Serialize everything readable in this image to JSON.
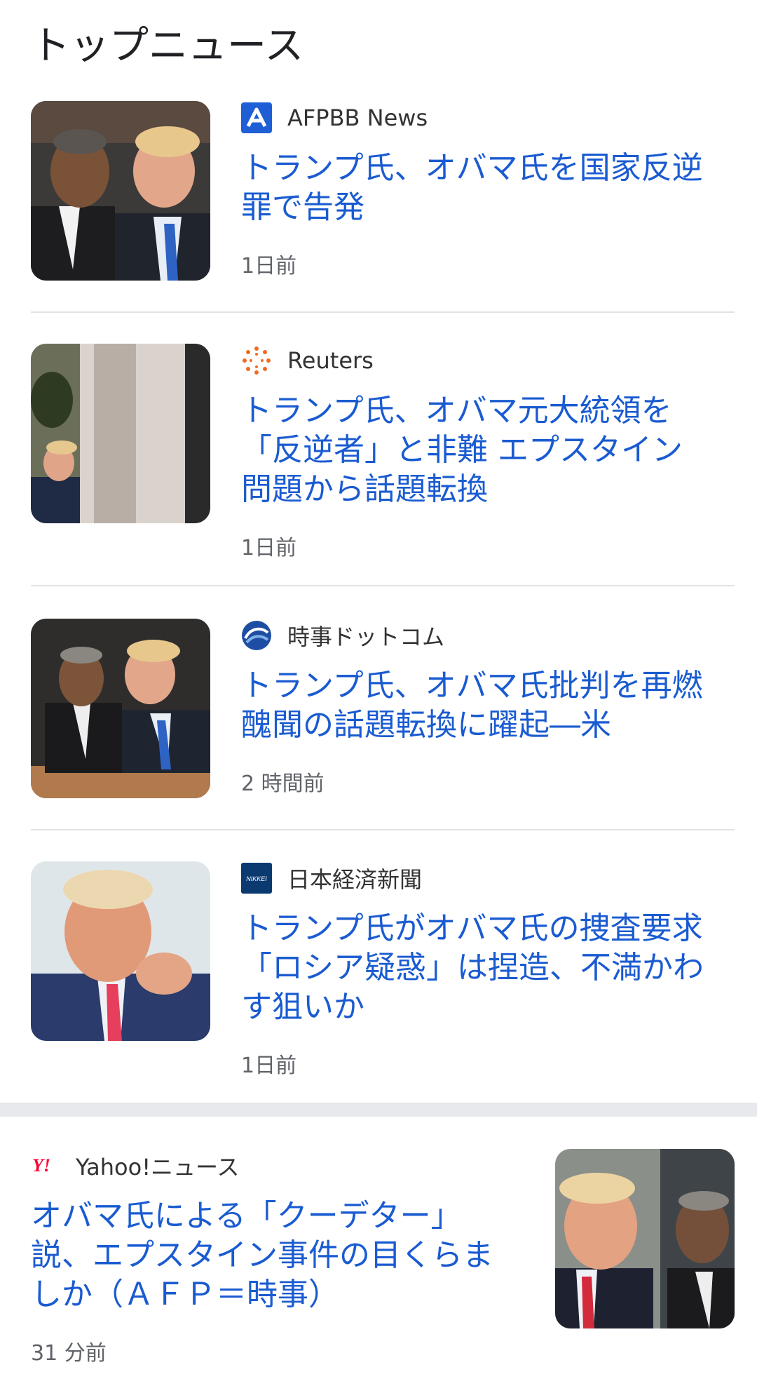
{
  "section": {
    "title": "トップニュース"
  },
  "articles": [
    {
      "source": "AFPBB News",
      "source_icon": "afpbb-logo-icon",
      "headline": "トランプ氏、オバマ氏を国家反逆罪で告発",
      "time": "1日前",
      "image": "obama-trump-conversation-photo"
    },
    {
      "source": "Reuters",
      "source_icon": "reuters-logo-icon",
      "headline": "トランプ氏、オバマ元大統領を「反逆者」と非難 エプスタイン問題から話題転換",
      "time": "1日前",
      "image": "trump-behind-pillar-photo"
    },
    {
      "source": "時事ドットコム",
      "source_icon": "jiji-logo-icon",
      "headline": "トランプ氏、オバマ氏批判を再燃 醜聞の話題転換に躍起―米",
      "time": "2 時間前",
      "image": "obama-trump-seated-photo"
    },
    {
      "source": "日本経済新聞",
      "source_icon": "nikkei-logo-icon",
      "headline": "トランプ氏がオバマ氏の捜査要求「ロシア疑惑」は捏造、不満かわす狙いか",
      "time": "1日前",
      "image": "trump-pointing-photo"
    }
  ],
  "featured": {
    "source": "Yahoo!ニュース",
    "source_icon": "yahoo-logo-icon",
    "headline": "オバマ氏による「クーデター」説、エプスタイン事件の目くらましか（ＡＦＰ＝時事）",
    "time": "31 分前",
    "image": "trump-obama-outdoor-photo"
  },
  "colors": {
    "headline": "#1a5bd1",
    "meta": "#5f6368",
    "divider": "#e3e3e3"
  }
}
